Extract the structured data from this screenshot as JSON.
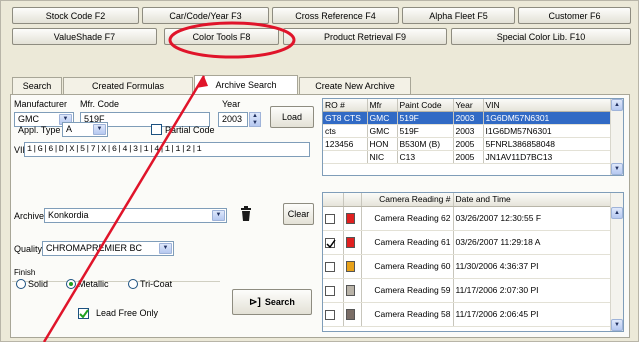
{
  "top_buttons_row1": [
    "Stock Code F2",
    "Car/Code/Year F3",
    "Cross Reference F4",
    "Alpha Fleet F5",
    "Customer F6"
  ],
  "top_buttons_row2": [
    "ValueShade F7",
    "Color Tools F8",
    "Product Retrieval F9",
    "Special Color Lib. F10"
  ],
  "tabs": [
    "Search",
    "Created Formulas",
    "Archive Search",
    "Create New Archive"
  ],
  "form": {
    "manufacturer_label": "Manufacturer",
    "mfr_code_label": "Mfr. Code",
    "year_label": "Year",
    "manufacturer_value": "GMC",
    "mfr_code_value": "519F",
    "year_value": "2003",
    "load_label": "Load",
    "appl_type_label": "Appl. Type",
    "appl_type_value": "A",
    "partial_code_label": "Partial Code",
    "vin_label": "VIN",
    "vin_value": "1|G|6|D|X|5|7|X|6|4|3|1|4|1|1|2|1",
    "archive_label": "Archive",
    "archive_value": "Konkordia",
    "clear_label": "Clear",
    "quality_label": "Quality",
    "quality_value": "CHROMAPREMIER BC",
    "finish_label": "Finish",
    "finish_options": [
      "Solid",
      "Metallic",
      "Tri-Coat"
    ],
    "finish_selected": "Metallic",
    "search_label": "Search",
    "lead_free_label": "Lead Free Only",
    "lead_free_checked": true
  },
  "results_table": {
    "columns": [
      "RO #",
      "Mfr",
      "Paint Code",
      "Year",
      "VIN"
    ],
    "rows": [
      [
        "GT8 CTS",
        "GMC",
        "519F",
        "2003",
        "1G6DM57N6301"
      ],
      [
        "cts",
        "GMC",
        "519F",
        "2003",
        "I1G6DM57N6301"
      ],
      [
        "123456",
        "HON",
        "B530M (B)",
        "2005",
        "5FNRL386858048"
      ],
      [
        "",
        "NIC",
        "C13",
        "2005",
        "JN1AV11D7BC13"
      ]
    ]
  },
  "camera_table": {
    "columns": [
      "",
      "",
      "Camera Reading #",
      "Date and Time"
    ],
    "rows": [
      {
        "checked": false,
        "color": "#e02020",
        "reading": "Camera Reading 62",
        "date": "03/26/2007 12:30:55 F"
      },
      {
        "checked": true,
        "color": "#e02020",
        "reading": "Camera Reading 61",
        "date": "03/26/2007 11:29:18 A"
      },
      {
        "checked": false,
        "color": "#e8a21a",
        "reading": "Camera Reading 60",
        "date": "11/30/2006 4:36:37 PI"
      },
      {
        "checked": false,
        "color": "#b9b3a8",
        "reading": "Camera Reading 59",
        "date": "11/17/2006 2:07:30 PI"
      },
      {
        "checked": false,
        "color": "#7a6d66",
        "reading": "Camera Reading 58",
        "date": "11/17/2006 2:06:45 PI"
      }
    ]
  },
  "annotation": {
    "color": "#e0142a"
  }
}
